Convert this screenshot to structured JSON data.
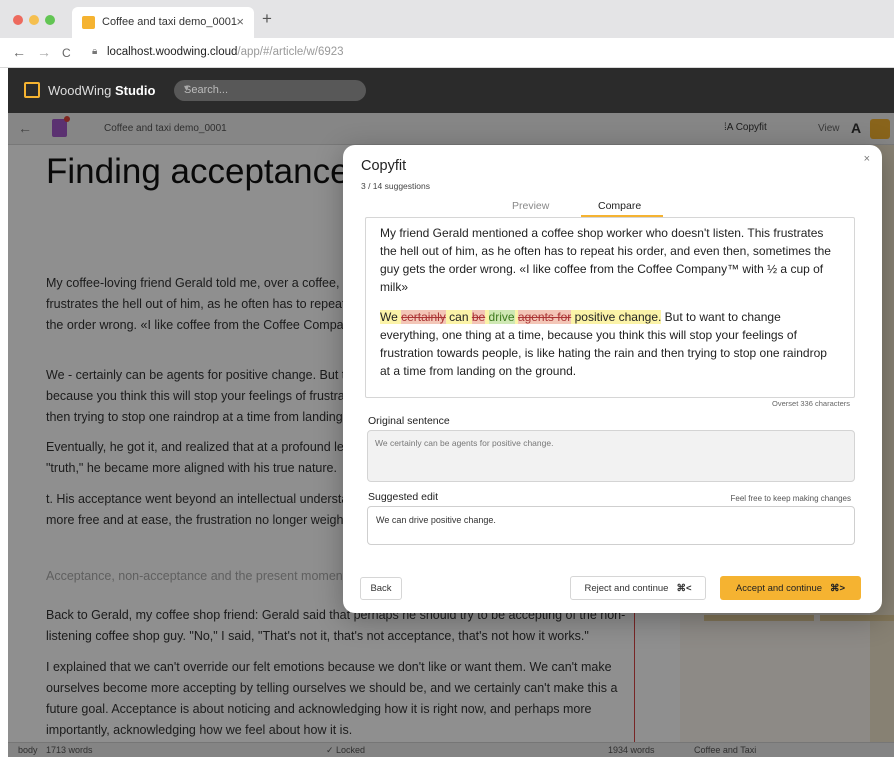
{
  "browser": {
    "dot_colors": [
      "#ed6a5e",
      "#f5bf4f",
      "#62c554"
    ],
    "tab_title": "Coffee and taxi demo_0001",
    "tab_close": "×",
    "new_tab": "+",
    "nav_back": "←",
    "nav_forward": "→",
    "nav_reload": "C",
    "url_host": "localhost.woodwing.cloud",
    "url_path": "/app/#/article/w/6923"
  },
  "app": {
    "brand_prefix": "WoodWing",
    "brand_name": "Studio",
    "search_placeholder": "Search...",
    "accent_color": "#f5b331"
  },
  "toolbar": {
    "article_name": "Coffee and taxi demo_0001",
    "copyfit_label": "Copyfit",
    "view_label": "View",
    "font_size_label": "A"
  },
  "article": {
    "title": "Finding acceptance acceptance",
    "paragraphs": [
      "My coffee-loving friend Gerald told me, over a coffee, that a coffee shop worker doesn't listen. This frustrates the hell out of him, as he often has to repeat his order, and even then, sometimes the guy gets the order wrong. «I like coffee from the Coffee Company™ with ½ a cup of milk»",
      "We - certainly can be agents for positive change. But to want to change everything, one thing at a time, because you think this will stop your feelings of frustration towards people, is like hating the rain and then trying to stop one raindrop at a time from landing on the ground.",
      "Eventually, he got it, and realized that at a profound level, nothing was wrong. Once he'd accepted this \"truth,\" he became more aligned with his true nature.",
      "t. His acceptance went beyond an intellectual understanding. Something in him clicked, and he became more free and at ease, the frustration no longer weighing him down.",
      "Acceptance, non-acceptance and the present moment",
      "Back to Gerald, my coffee shop friend: Gerald said that perhaps he should try to be accepting of the non-listening coffee shop guy. \"No,\" I said, \"That's not it, that's not acceptance, that's not how it works.\"",
      "I explained that we can't override our felt emotions because we don't like or want them. We can't make ourselves become more accepting by telling ourselves we should be, and we certainly can't make this a future goal. Acceptance is about noticing and acknowledging how it is right now, and perhaps more importantly, acknowledging how we feel about how it is."
    ]
  },
  "status_bar": {
    "style": "body",
    "word_count": "1713 words",
    "lock_state": "✓ Locked",
    "right_word_count": "1934 words",
    "right_title": "Coffee and Taxi"
  },
  "dialog": {
    "title": "Copyfit",
    "progress": "3 / 14 suggestions",
    "close": "×",
    "tabs": [
      {
        "label": "Preview",
        "active": false
      },
      {
        "label": "Compare",
        "active": true
      }
    ],
    "compare": {
      "paragraph1": "My friend Gerald mentioned a coffee shop worker who doesn't listen. This frustrates the hell out of him, as he often has to repeat his order, and even then, sometimes the guy gets the order wrong. «I like coffee from the Coffee Company™ with ½ a cup of milk»",
      "we": "We ",
      "del_certainly": "certainly",
      "can": " can ",
      "del_be": "be",
      "ins_drive": "drive",
      "del_agents": "agents for",
      "positive": " positive change.",
      "rest": "  But to want to change everything, one thing at a time, because you think this will stop your feelings of frustration towards people, is like hating the rain and then trying to stop one raindrop at a time from landing on the ground."
    },
    "overset": "Overset 336 characters",
    "original_label": "Original sentence",
    "original_text": "We certainly can be agents for positive change.",
    "suggested_label": "Suggested edit",
    "keep_editing_hint": "Feel free to keep making changes",
    "suggested_text": "We can drive positive change.",
    "back_label": "Back",
    "reject_label": "Reject and continue",
    "reject_shortcut": "⌘<",
    "accept_label": "Accept and continue",
    "accept_shortcut": "⌘>"
  }
}
